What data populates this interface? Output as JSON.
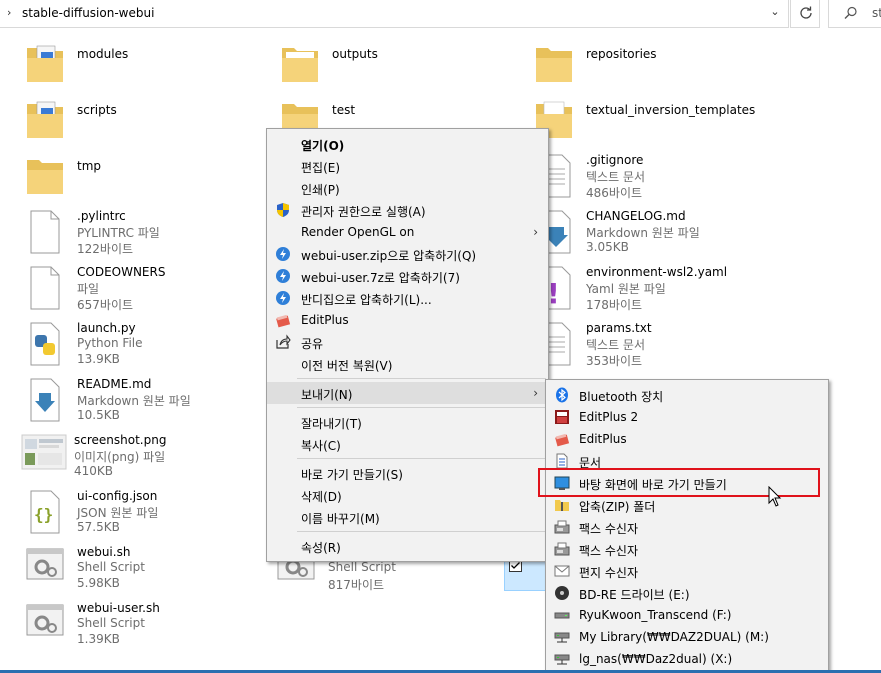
{
  "address": {
    "separator": "›",
    "path": "stable-diffusion-webui",
    "dropdown": "⌄"
  },
  "search": {
    "placeholder": "st"
  },
  "items": [
    {
      "name": "modules",
      "icon": "folder-docs-icon"
    },
    {
      "name": "outputs",
      "icon": "folder-icon"
    },
    {
      "name": "repositories",
      "icon": "folder-icon"
    },
    {
      "name": "scripts",
      "icon": "folder-docs-icon"
    },
    {
      "name": "test",
      "icon": "folder-icon"
    },
    {
      "name": "textual_inversion_templates",
      "icon": "folder-icon"
    },
    {
      "name": "tmp",
      "icon": "folder-icon"
    },
    {
      "name": ".gitignore",
      "type": "텍스트 문서",
      "size": "486바이트",
      "icon": "text-file-icon"
    },
    {
      "name": ".pylintrc",
      "type": "PYLINTRC 파일",
      "size": "122바이트",
      "icon": "blank-file-icon"
    },
    {
      "name": "CHANGELOG.md",
      "type": "Markdown 원본 파일",
      "size": "3.05KB",
      "icon": "markdown-icon"
    },
    {
      "name": "CODEOWNERS",
      "type": "파일",
      "size": "657바이트",
      "icon": "blank-file-icon"
    },
    {
      "name": "environment-wsl2.yaml",
      "type": "Yaml 원본 파일",
      "size": "178바이트",
      "icon": "yaml-icon"
    },
    {
      "name": "launch.py",
      "type": "Python File",
      "size": "13.9KB",
      "icon": "python-icon"
    },
    {
      "name": "params.txt",
      "type": "텍스트 문서",
      "size": "353바이트",
      "icon": "text-file-icon"
    },
    {
      "name": "README.md",
      "type": "Markdown 원본 파일",
      "size": "10.5KB",
      "icon": "markdown-icon"
    },
    {
      "name": "screenshot.png",
      "type": "이미지(png) 파일",
      "size": "410KB",
      "icon": "image-thumbnail-icon"
    },
    {
      "name": "ui-config.json",
      "type": "JSON 원본 파일",
      "size": "57.5KB",
      "icon": "json-icon"
    },
    {
      "name": "webui.sh",
      "type": "Shell Script",
      "size": "5.98KB",
      "icon": "shell-script-icon"
    },
    {
      "name": "",
      "type": "Shell Script",
      "size": "817바이트",
      "icon": "shell-script-icon"
    },
    {
      "name": "webui-user.sh",
      "type": "Shell Script",
      "size": "1.39KB",
      "icon": "shell-script-icon"
    }
  ],
  "context_menu": [
    {
      "label": "열기(O)",
      "bold": true
    },
    {
      "label": "편집(E)"
    },
    {
      "label": "인쇄(P)"
    },
    {
      "label": "관리자 권한으로 실행(A)",
      "icon": "uac-shield-icon"
    },
    {
      "label": "Render OpenGL on",
      "submenu": true
    },
    {
      "label": "webui-user.zip으로 압축하기(Q)",
      "icon": "bandizip-icon"
    },
    {
      "label": "webui-user.7z로 압축하기(7)",
      "icon": "bandizip-icon"
    },
    {
      "label": "반디집으로 압축하기(L)...",
      "icon": "bandizip-icon"
    },
    {
      "label": "EditPlus",
      "icon": "editplus-icon"
    },
    {
      "label": "공유",
      "icon": "share-icon"
    },
    {
      "label": "이전 버전 복원(V)"
    },
    {
      "label": "보내기(N)",
      "submenu": true,
      "highlighted": true
    },
    {
      "label": "잘라내기(T)"
    },
    {
      "label": "복사(C)"
    },
    {
      "label": "바로 가기 만들기(S)"
    },
    {
      "label": "삭제(D)"
    },
    {
      "label": "이름 바꾸기(M)"
    },
    {
      "label": "속성(R)"
    }
  ],
  "send_to_menu": [
    {
      "label": "Bluetooth 장치",
      "icon": "bluetooth-icon"
    },
    {
      "label": "EditPlus 2",
      "icon": "editplus2-icon"
    },
    {
      "label": "EditPlus",
      "icon": "editplus-icon"
    },
    {
      "label": "문서",
      "icon": "documents-icon"
    },
    {
      "label": "바탕 화면에 바로 가기 만들기",
      "icon": "desktop-icon",
      "highlighted": true
    },
    {
      "label": "압축(ZIP) 폴더",
      "icon": "zip-folder-icon"
    },
    {
      "label": "팩스 수신자",
      "icon": "fax-icon"
    },
    {
      "label": "팩스 수신자",
      "icon": "fax-icon"
    },
    {
      "label": "편지 수신자",
      "icon": "mail-icon"
    },
    {
      "label": "BD-RE 드라이브 (E:)",
      "icon": "disc-drive-icon"
    },
    {
      "label": "RyuKwoon_Transcend (F:)",
      "icon": "usb-drive-icon"
    },
    {
      "label": "My Library(₩₩DAZ2DUAL) (M:)",
      "icon": "network-drive-icon"
    },
    {
      "label": "lg_nas(₩₩Daz2dual) (X:)",
      "icon": "network-drive-icon"
    }
  ]
}
